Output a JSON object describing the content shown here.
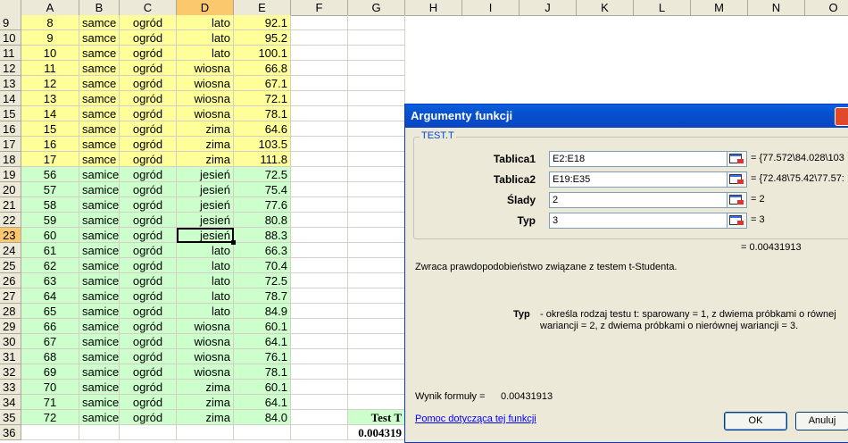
{
  "columns": [
    "A",
    "B",
    "C",
    "D",
    "E",
    "F",
    "G",
    "H",
    "I",
    "J",
    "K",
    "L",
    "M",
    "N",
    "O"
  ],
  "selected_column": "D",
  "rows": [
    {
      "n": "9",
      "a": "8",
      "b": "samce",
      "c": "ogród",
      "d": "lato",
      "e": "92.1",
      "fill": "yellow"
    },
    {
      "n": "10",
      "a": "9",
      "b": "samce",
      "c": "ogród",
      "d": "lato",
      "e": "95.2",
      "fill": "yellow"
    },
    {
      "n": "11",
      "a": "10",
      "b": "samce",
      "c": "ogród",
      "d": "lato",
      "e": "100.1",
      "fill": "yellow"
    },
    {
      "n": "12",
      "a": "11",
      "b": "samce",
      "c": "ogród",
      "d": "wiosna",
      "e": "66.8",
      "fill": "yellow"
    },
    {
      "n": "13",
      "a": "12",
      "b": "samce",
      "c": "ogród",
      "d": "wiosna",
      "e": "67.1",
      "fill": "yellow"
    },
    {
      "n": "14",
      "a": "13",
      "b": "samce",
      "c": "ogród",
      "d": "wiosna",
      "e": "72.1",
      "fill": "yellow"
    },
    {
      "n": "15",
      "a": "14",
      "b": "samce",
      "c": "ogród",
      "d": "wiosna",
      "e": "78.1",
      "fill": "yellow"
    },
    {
      "n": "16",
      "a": "15",
      "b": "samce",
      "c": "ogród",
      "d": "zima",
      "e": "64.6",
      "fill": "yellow"
    },
    {
      "n": "17",
      "a": "16",
      "b": "samce",
      "c": "ogród",
      "d": "zima",
      "e": "103.5",
      "fill": "yellow"
    },
    {
      "n": "18",
      "a": "17",
      "b": "samce",
      "c": "ogród",
      "d": "zima",
      "e": "111.8",
      "fill": "yellow"
    },
    {
      "n": "19",
      "a": "56",
      "b": "samice",
      "c": "ogród",
      "d": "jesień",
      "e": "72.5",
      "fill": "green"
    },
    {
      "n": "20",
      "a": "57",
      "b": "samice",
      "c": "ogród",
      "d": "jesień",
      "e": "75.4",
      "fill": "green"
    },
    {
      "n": "21",
      "a": "58",
      "b": "samice",
      "c": "ogród",
      "d": "jesień",
      "e": "77.6",
      "fill": "green"
    },
    {
      "n": "22",
      "a": "59",
      "b": "samice",
      "c": "ogród",
      "d": "jesień",
      "e": "80.8",
      "fill": "green"
    },
    {
      "n": "23",
      "a": "60",
      "b": "samice",
      "c": "ogród",
      "d": "jesień",
      "e": "88.3",
      "fill": "green",
      "active": true
    },
    {
      "n": "24",
      "a": "61",
      "b": "samice",
      "c": "ogród",
      "d": "lato",
      "e": "66.3",
      "fill": "green"
    },
    {
      "n": "25",
      "a": "62",
      "b": "samice",
      "c": "ogród",
      "d": "lato",
      "e": "70.4",
      "fill": "green"
    },
    {
      "n": "26",
      "a": "63",
      "b": "samice",
      "c": "ogród",
      "d": "lato",
      "e": "72.5",
      "fill": "green"
    },
    {
      "n": "27",
      "a": "64",
      "b": "samice",
      "c": "ogród",
      "d": "lato",
      "e": "78.7",
      "fill": "green"
    },
    {
      "n": "28",
      "a": "65",
      "b": "samice",
      "c": "ogród",
      "d": "lato",
      "e": "84.9",
      "fill": "green"
    },
    {
      "n": "29",
      "a": "66",
      "b": "samice",
      "c": "ogród",
      "d": "wiosna",
      "e": "60.1",
      "fill": "green"
    },
    {
      "n": "30",
      "a": "67",
      "b": "samice",
      "c": "ogród",
      "d": "wiosna",
      "e": "64.1",
      "fill": "green"
    },
    {
      "n": "31",
      "a": "68",
      "b": "samice",
      "c": "ogród",
      "d": "wiosna",
      "e": "76.1",
      "fill": "green"
    },
    {
      "n": "32",
      "a": "69",
      "b": "samice",
      "c": "ogród",
      "d": "wiosna",
      "e": "78.1",
      "fill": "green"
    },
    {
      "n": "33",
      "a": "70",
      "b": "samice",
      "c": "ogród",
      "d": "zima",
      "e": "60.1",
      "fill": "green"
    },
    {
      "n": "34",
      "a": "71",
      "b": "samice",
      "c": "ogród",
      "d": "zima",
      "e": "64.1",
      "fill": "green"
    },
    {
      "n": "35",
      "a": "72",
      "b": "samice",
      "c": "ogród",
      "d": "zima",
      "e": "84.0",
      "fill": "green"
    },
    {
      "n": "36",
      "a": "",
      "b": "",
      "c": "",
      "d": "",
      "e": "",
      "fill": "none"
    }
  ],
  "g35": "Test T",
  "g36": "0.004319",
  "colors": {
    "yellow": "#ffff99",
    "green": "#ccffcc",
    "header": "#ece9d8",
    "selected_header": "#fbc86d"
  },
  "dialog": {
    "title": "Argumenty funkcji",
    "function_name": "TEST.T",
    "args": [
      {
        "label": "Tablica1",
        "value": "E2:E18",
        "result": "= {77.572\\84.028\\103"
      },
      {
        "label": "Tablica2",
        "value": "E19:E35",
        "result": "= {72.48\\75.42\\77.57:"
      },
      {
        "label": "Ślady",
        "value": "2",
        "result": "= 2"
      },
      {
        "label": "Typ",
        "value": "3",
        "result": "= 3"
      }
    ],
    "function_result": "= 0.00431913",
    "description": "Zwraca prawdopodobieństwo związane z testem t-Studenta.",
    "param_name": "Typ",
    "param_desc_line1": "- określa rodzaj testu t: sparowany = 1, z dwiema próbkami o równej",
    "param_desc_line2": "wariancji = 2, z dwiema próbkami o nierównej wariancji = 3.",
    "formula_result_label": "Wynik formuły =",
    "formula_result_value": "0.00431913",
    "help_link": "Pomoc dotycząca tej funkcji",
    "ok_label": "OK",
    "cancel_label": "Anuluj"
  }
}
